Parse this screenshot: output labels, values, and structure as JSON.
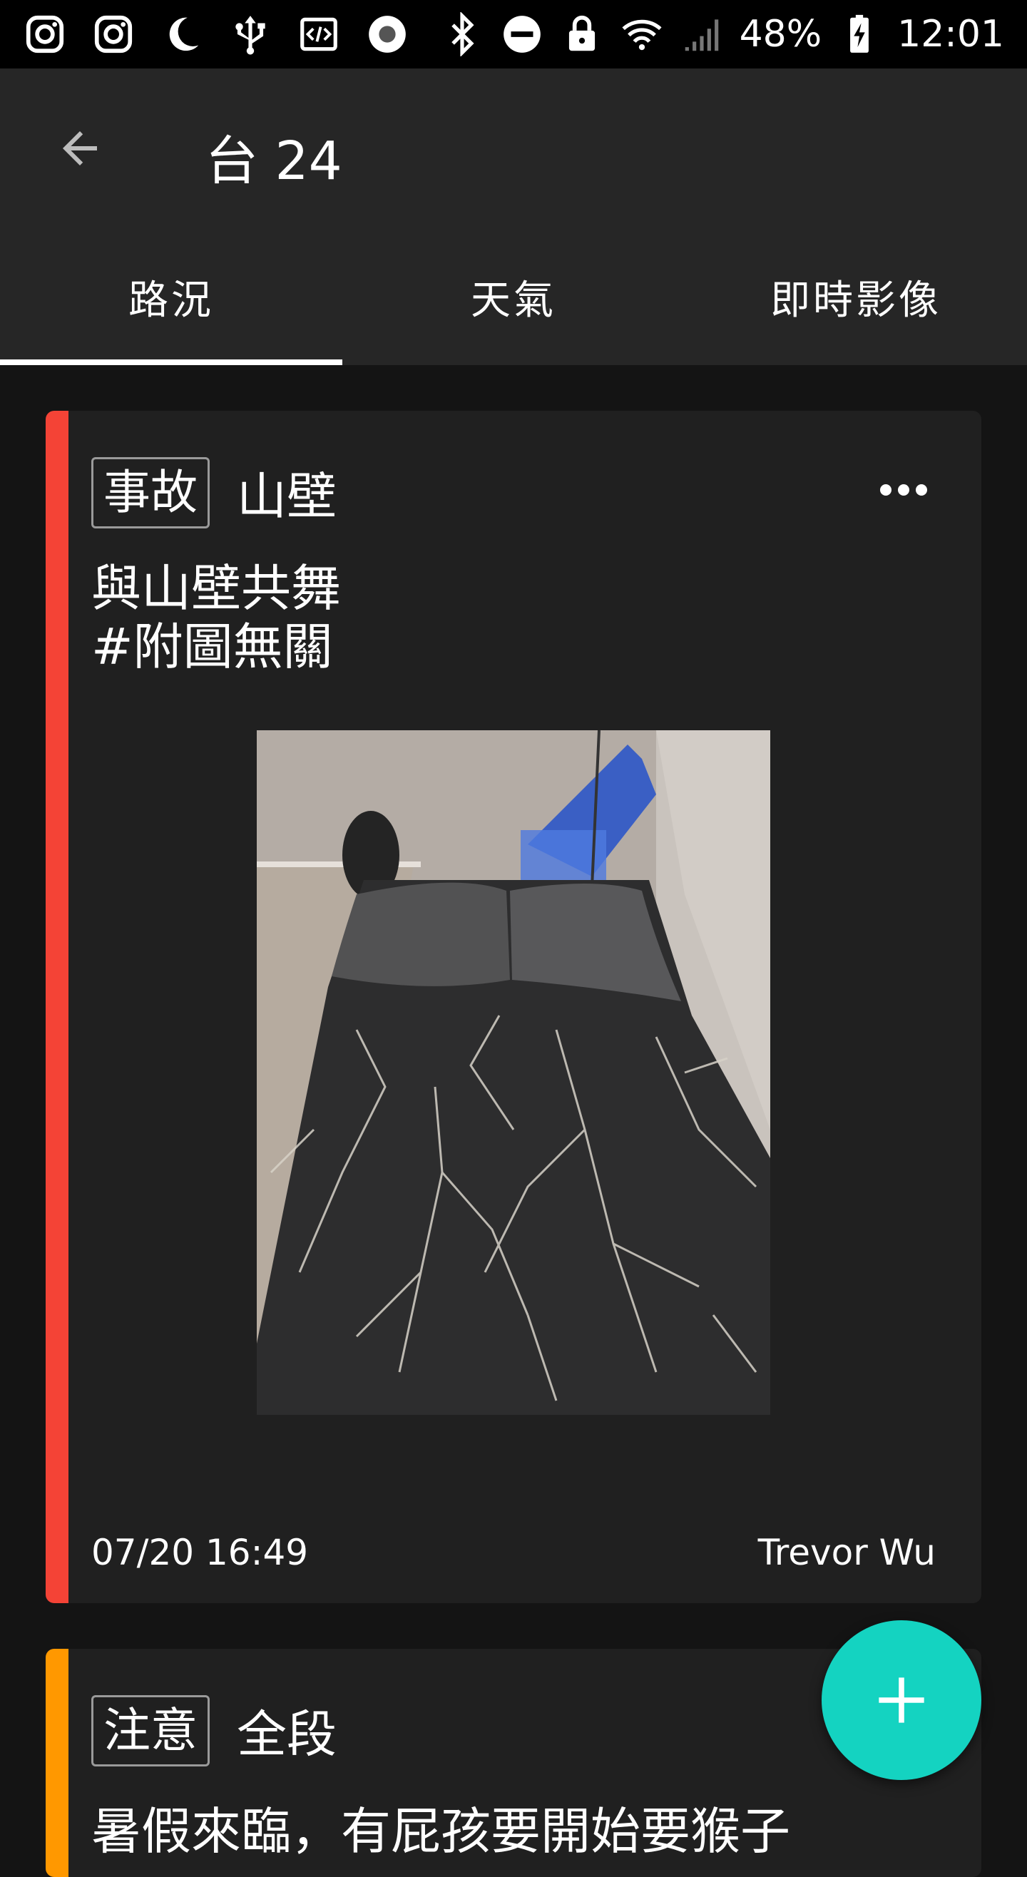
{
  "status_bar": {
    "battery": "48%",
    "time": "12:01",
    "icons_left": [
      "instagram-icon",
      "instagram-icon",
      "moon-icon",
      "usb-icon",
      "code-icon",
      "record-icon"
    ],
    "icons_right": [
      "bluetooth-icon",
      "do-not-disturb-icon",
      "lock-icon",
      "wifi-icon",
      "signal-icon",
      "battery-charging-icon"
    ]
  },
  "app_bar": {
    "title": "台 24",
    "back_icon": "arrow-back-icon"
  },
  "tabs": [
    {
      "label": "路況",
      "active": true
    },
    {
      "label": "天氣",
      "active": false
    },
    {
      "label": "即時影像",
      "active": false
    }
  ],
  "cards": [
    {
      "accent_color": "#f44336",
      "tag": "事故",
      "location": "山壁",
      "description_lines": [
        "與山壁共舞",
        "#附圖無關"
      ],
      "timestamp": "07/20 16:49",
      "author": "Trevor Wu",
      "more_icon": "more-horizontal-icon"
    },
    {
      "accent_color": "#ff9800",
      "tag": "注意",
      "location": "全段",
      "description": "暑假來臨，有屁孩要開始要猴子"
    }
  ],
  "fab": {
    "icon": "plus-icon",
    "color": "#14d3c1"
  }
}
